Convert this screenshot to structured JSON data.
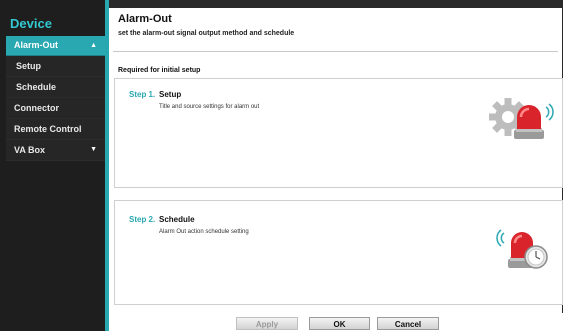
{
  "sidebar": {
    "title": "Device",
    "items": [
      {
        "label": "Alarm-Out",
        "state": "active",
        "caret": "▲"
      },
      {
        "label": "Setup"
      },
      {
        "label": "Schedule"
      },
      {
        "label": "Connector"
      },
      {
        "label": "Remote Control"
      },
      {
        "label": "VA Box",
        "caret": "▼"
      }
    ]
  },
  "page": {
    "title": "Alarm-Out",
    "subtitle": "set the alarm-out signal output method and schedule",
    "section_label": "Required for initial setup"
  },
  "steps": [
    {
      "number": "Step 1.",
      "title": "Setup",
      "description": "Title and source settings for alarm out",
      "icon": "gear-siren-icon"
    },
    {
      "number": "Step 2.",
      "title": "Schedule",
      "description": "Alarm Out action schedule setting",
      "icon": "siren-clock-icon"
    }
  ],
  "buttons": {
    "apply": "Apply",
    "ok": "OK",
    "cancel": "Cancel"
  },
  "colors": {
    "accent": "#2aa8b2",
    "sidebar_bg": "#1e1e1e",
    "siren_red": "#d9242c"
  }
}
